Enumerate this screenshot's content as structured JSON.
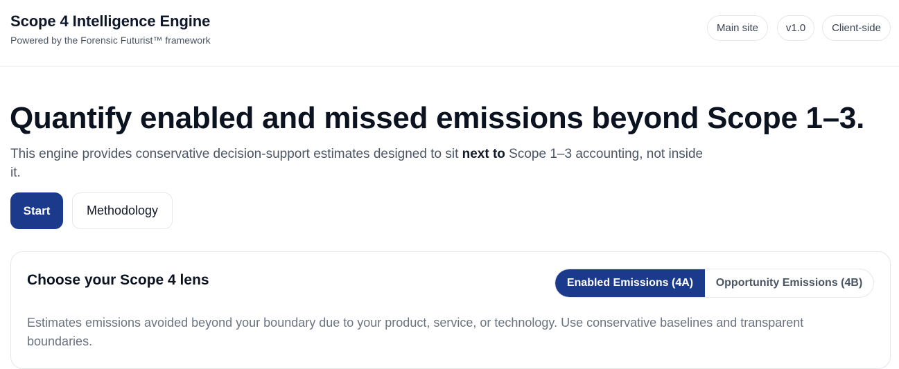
{
  "header": {
    "title": "Scope 4 Intelligence Engine",
    "subtitle": "Powered by the Forensic Futurist™ framework",
    "pills": {
      "main_site": "Main site",
      "version": "v1.0",
      "client_side": "Client-side"
    }
  },
  "hero": {
    "title": "Quantify enabled and missed emissions beyond Scope 1–3.",
    "desc_before": "This engine provides conservative decision-support estimates designed to sit ",
    "desc_bold": "next to",
    "desc_after": " Scope 1–3 accounting, not inside it.",
    "start_label": "Start",
    "methodology_label": "Methodology"
  },
  "lens_card": {
    "title": "Choose your Scope 4 lens",
    "options": {
      "enabled": "Enabled Emissions (4A)",
      "opportunity": "Opportunity Emissions (4B)"
    },
    "selected": "enabled",
    "description": "Estimates emissions avoided beyond your boundary due to your product, service, or technology. Use conservative baselines and transparent boundaries."
  },
  "colors": {
    "primary": "#1b3a8c",
    "border": "#e5e7eb",
    "muted_text": "#4b5563"
  }
}
